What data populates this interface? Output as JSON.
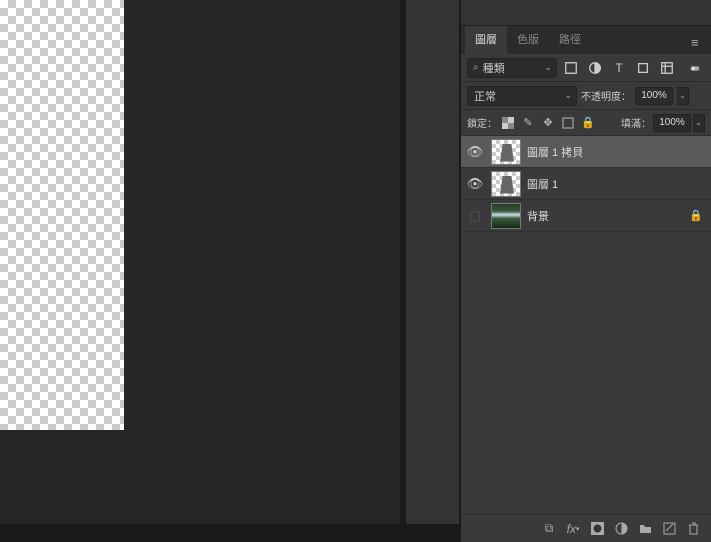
{
  "tabs": {
    "layers": "圖層",
    "channels": "色版",
    "paths": "路徑"
  },
  "filter": {
    "label": "種類"
  },
  "blend": {
    "mode": "正常"
  },
  "opacity": {
    "label": "不透明度：",
    "value": "100%"
  },
  "fill": {
    "label": "填滿：",
    "value": "100%"
  },
  "lock": {
    "label": "鎖定："
  },
  "layers": [
    {
      "name": "圖層 1 拷貝",
      "visible": true,
      "selected": true,
      "locked": false,
      "thumb": "shape"
    },
    {
      "name": "圖層 1",
      "visible": true,
      "selected": false,
      "locked": false,
      "thumb": "shape"
    },
    {
      "name": "背景",
      "visible": false,
      "selected": false,
      "locked": true,
      "thumb": "waterfall"
    }
  ]
}
